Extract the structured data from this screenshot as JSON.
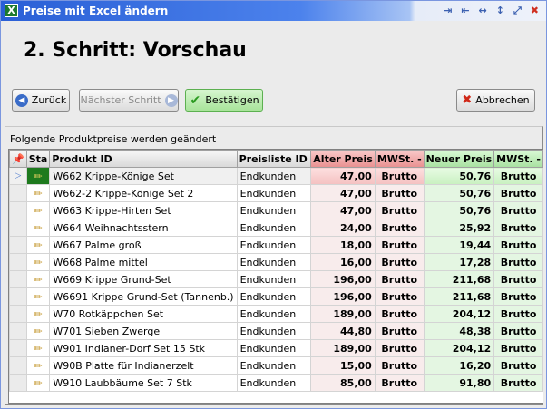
{
  "window": {
    "title": "Preise mit Excel ändern",
    "app_icon": "excel-icon",
    "title_icons": [
      "collapse-icon",
      "expand-icon",
      "resize-horizontal-icon",
      "resize-vertical-icon",
      "maximize-icon",
      "close-icon"
    ]
  },
  "heading": "2. Schritt: Vorschau",
  "buttons": {
    "back": "Zurück",
    "next": "Nächster Schritt",
    "confirm": "Bestätigen",
    "cancel": "Abbrechen"
  },
  "caption": "Folgende Produktpreise werden geändert",
  "columns": [
    "Sta",
    "Produkt ID",
    "Preisliste ID",
    "Alter Preis",
    "MWSt. -",
    "Neuer Preis",
    "MWSt. -"
  ],
  "rows": [
    {
      "product": "W662 Krippe-Könige Set",
      "pricelist": "Endkunden",
      "old": "47,00",
      "old_tax": "Brutto",
      "new": "50,76",
      "new_tax": "Brutto"
    },
    {
      "product": "W662-2 Krippe-Könige Set 2",
      "pricelist": "Endkunden",
      "old": "47,00",
      "old_tax": "Brutto",
      "new": "50,76",
      "new_tax": "Brutto"
    },
    {
      "product": "W663 Krippe-Hirten Set",
      "pricelist": "Endkunden",
      "old": "47,00",
      "old_tax": "Brutto",
      "new": "50,76",
      "new_tax": "Brutto"
    },
    {
      "product": "W664 Weihnachtsstern",
      "pricelist": "Endkunden",
      "old": "24,00",
      "old_tax": "Brutto",
      "new": "25,92",
      "new_tax": "Brutto"
    },
    {
      "product": "W667 Palme groß",
      "pricelist": "Endkunden",
      "old": "18,00",
      "old_tax": "Brutto",
      "new": "19,44",
      "new_tax": "Brutto"
    },
    {
      "product": "W668 Palme mittel",
      "pricelist": "Endkunden",
      "old": "16,00",
      "old_tax": "Brutto",
      "new": "17,28",
      "new_tax": "Brutto"
    },
    {
      "product": "W669 Krippe Grund-Set",
      "pricelist": "Endkunden",
      "old": "196,00",
      "old_tax": "Brutto",
      "new": "211,68",
      "new_tax": "Brutto"
    },
    {
      "product": "W6691 Krippe Grund-Set (Tannenb.)",
      "pricelist": "Endkunden",
      "old": "196,00",
      "old_tax": "Brutto",
      "new": "211,68",
      "new_tax": "Brutto"
    },
    {
      "product": "W70 Rotkäppchen Set",
      "pricelist": "Endkunden",
      "old": "189,00",
      "old_tax": "Brutto",
      "new": "204,12",
      "new_tax": "Brutto"
    },
    {
      "product": "W701 Sieben Zwerge",
      "pricelist": "Endkunden",
      "old": "44,80",
      "old_tax": "Brutto",
      "new": "48,38",
      "new_tax": "Brutto"
    },
    {
      "product": "W901 Indianer-Dorf Set 15 Stk",
      "pricelist": "Endkunden",
      "old": "189,00",
      "old_tax": "Brutto",
      "new": "204,12",
      "new_tax": "Brutto"
    },
    {
      "product": "W90B Platte für Indianerzelt",
      "pricelist": "Endkunden",
      "old": "15,00",
      "old_tax": "Brutto",
      "new": "16,20",
      "new_tax": "Brutto"
    },
    {
      "product": "W910 Laubbäume Set 7 Stk",
      "pricelist": "Endkunden",
      "old": "85,00",
      "old_tax": "Brutto",
      "new": "91,80",
      "new_tax": "Brutto"
    }
  ]
}
